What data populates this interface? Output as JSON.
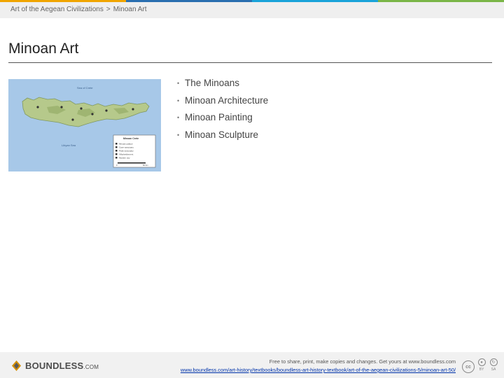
{
  "colors": {
    "top_strip": [
      "#f0a500",
      "#2a6fb0",
      "#1aa3d9",
      "#7ab648"
    ],
    "breadcrumb_bg": "#efefef",
    "footer_bg": "#f1f1f1",
    "link": "#0033aa",
    "map_sea": "#a7c8e8",
    "map_land": "#b6c98b"
  },
  "breadcrumb": {
    "parent": "Art of the Aegean Civilizations",
    "separator": ">",
    "current": "Minoan Art"
  },
  "page": {
    "title": "Minoan Art"
  },
  "figure": {
    "description_icon": "map-of-crete",
    "sea_top_label": "Sea of Crete",
    "sea_bottom_label": "Libyan Sea",
    "legend_title": "Minoan Crete",
    "legend_items": [
      "Minoan palace",
      "Cave sanctuary",
      "Peak sanctuary",
      "Villa/settlement",
      "Modern city"
    ],
    "scale_start": "0",
    "scale_end": "50 km"
  },
  "topics": [
    {
      "label": "The Minoans"
    },
    {
      "label": "Minoan Architecture"
    },
    {
      "label": "Minoan Painting"
    },
    {
      "label": "Minoan Sculpture"
    }
  ],
  "footer": {
    "logo_icon": "boundless-logo-icon",
    "logo_word": "BOUNDLESS",
    "logo_suffix": ".COM",
    "notice": "Free to share, print, make copies and changes. Get yours at www.boundless.com",
    "url": "www.boundless.com/art-history/textbooks/boundless-art-history-textbook/art-of-the-aegean-civilizations-5/minoan-art-50/",
    "license_icon": "cc-by-sa-icon",
    "license_cc": "cc",
    "license_by": "BY",
    "license_sa": "SA"
  }
}
